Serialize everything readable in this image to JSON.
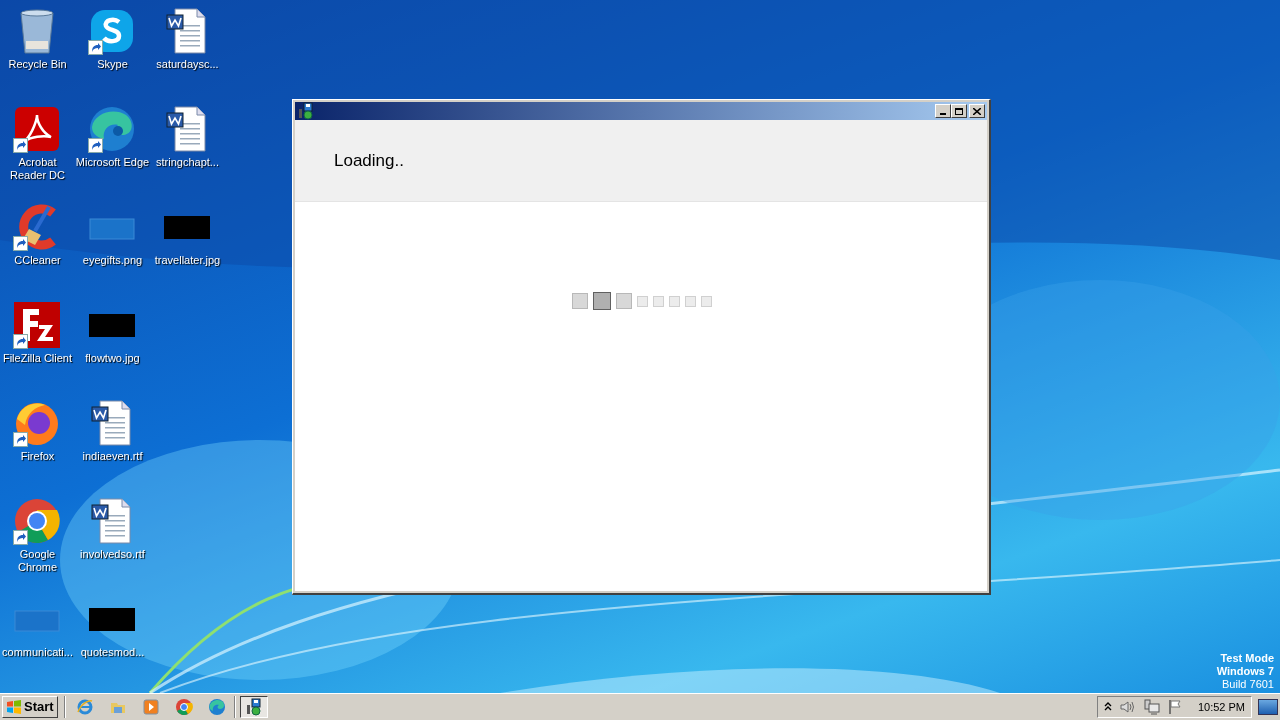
{
  "desktop": {
    "icons": [
      {
        "label": "Recycle Bin",
        "kind": "recycle",
        "shortcut": false
      },
      {
        "label": "Acrobat Reader DC",
        "kind": "acrobat",
        "shortcut": true
      },
      {
        "label": "CCleaner",
        "kind": "ccleaner",
        "shortcut": true
      },
      {
        "label": "FileZilla Client",
        "kind": "filezilla",
        "shortcut": true
      },
      {
        "label": "Firefox",
        "kind": "firefox",
        "shortcut": true
      },
      {
        "label": "Google Chrome",
        "kind": "chrome",
        "shortcut": true
      },
      {
        "label": "communicati...",
        "kind": "blank-image",
        "shortcut": false
      },
      {
        "label": "Skype",
        "kind": "skype",
        "shortcut": true
      },
      {
        "label": "Microsoft Edge",
        "kind": "edge",
        "shortcut": true
      },
      {
        "label": "eyegifts.png",
        "kind": "blank-image",
        "shortcut": false
      },
      {
        "label": "flowtwo.jpg",
        "kind": "black-image",
        "shortcut": false
      },
      {
        "label": "indiaeven.rtf",
        "kind": "word",
        "shortcut": false
      },
      {
        "label": "involvedso.rtf",
        "kind": "word",
        "shortcut": false
      },
      {
        "label": "quotesmod...",
        "kind": "black-image",
        "shortcut": false
      },
      {
        "label": "saturdaysc...",
        "kind": "word",
        "shortcut": false
      },
      {
        "label": "stringchapt...",
        "kind": "word",
        "shortcut": false
      },
      {
        "label": "travellater.jpg",
        "kind": "black-image",
        "shortcut": false
      }
    ],
    "watermark_text": [
      "Test Mode",
      "Windows 7",
      "Build 7601"
    ]
  },
  "window": {
    "message": "Loading..",
    "loader": [
      {
        "kind": "near"
      },
      {
        "kind": "active"
      },
      {
        "kind": "near"
      },
      {
        "kind": "idle"
      },
      {
        "kind": "idle"
      },
      {
        "kind": "idle"
      },
      {
        "kind": "idle"
      },
      {
        "kind": "idle"
      }
    ]
  },
  "taskbar": {
    "start": "Start",
    "quick_launch": [
      {
        "kind": "ie"
      },
      {
        "kind": "folder"
      },
      {
        "kind": "media"
      },
      {
        "kind": "chrome"
      },
      {
        "kind": "edge"
      }
    ],
    "tasks": [
      {
        "kind": "installer",
        "selected": true
      }
    ],
    "clock": "10:52 PM"
  }
}
